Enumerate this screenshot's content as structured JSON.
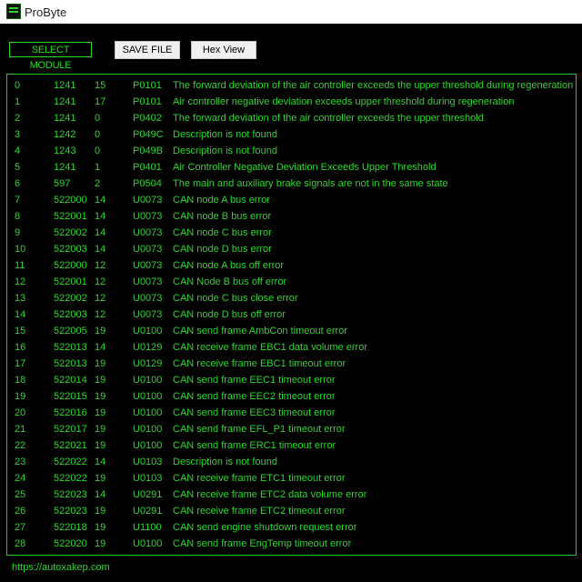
{
  "window": {
    "title": "ProByte"
  },
  "toolbar": {
    "select_module": "SELECT MODULE",
    "save_file": "SAVE FILE",
    "hex_view": "Hex View"
  },
  "rows": [
    {
      "idx": "0",
      "a": "1241",
      "b": "15",
      "code": "P0101",
      "desc": "The forward deviation of the air controller exceeds the upper threshold during regeneration"
    },
    {
      "idx": "1",
      "a": "1241",
      "b": "17",
      "code": "P0101",
      "desc": "Air controller negative deviation exceeds upper threshold during regeneration"
    },
    {
      "idx": "2",
      "a": "1241",
      "b": "0",
      "code": "P0402",
      "desc": "The forward deviation of the air controller exceeds the upper threshold"
    },
    {
      "idx": "3",
      "a": "1242",
      "b": "0",
      "code": "P049C",
      "desc": "Description is not found"
    },
    {
      "idx": "4",
      "a": "1243",
      "b": "0",
      "code": "P049B",
      "desc": "Description is not found"
    },
    {
      "idx": "5",
      "a": "1241",
      "b": "1",
      "code": "P0401",
      "desc": "Air Controller Negative Deviation Exceeds Upper Threshold"
    },
    {
      "idx": "6",
      "a": "597",
      "b": "2",
      "code": "P0504",
      "desc": "The main and auxiliary brake signals are not in the same state"
    },
    {
      "idx": "7",
      "a": "522000",
      "b": "14",
      "code": "U0073",
      "desc": "CAN node A bus error"
    },
    {
      "idx": "8",
      "a": "522001",
      "b": "14",
      "code": "U0073",
      "desc": "CAN node B bus error"
    },
    {
      "idx": "9",
      "a": "522002",
      "b": "14",
      "code": "U0073",
      "desc": "CAN node C bus error"
    },
    {
      "idx": "10",
      "a": "522003",
      "b": "14",
      "code": "U0073",
      "desc": "CAN node D bus error"
    },
    {
      "idx": "11",
      "a": "522000",
      "b": "12",
      "code": "U0073",
      "desc": "CAN node A bus off error"
    },
    {
      "idx": "12",
      "a": "522001",
      "b": "12",
      "code": "U0073",
      "desc": "CAN Node B bus off error"
    },
    {
      "idx": "13",
      "a": "522002",
      "b": "12",
      "code": "U0073",
      "desc": "CAN node C bus close error"
    },
    {
      "idx": "14",
      "a": "522003",
      "b": "12",
      "code": "U0073",
      "desc": "CAN node D bus off error"
    },
    {
      "idx": "15",
      "a": "522005",
      "b": "19",
      "code": "U0100",
      "desc": "CAN send frame AmbCon timeout error"
    },
    {
      "idx": "16",
      "a": "522013",
      "b": "14",
      "code": "U0129",
      "desc": "CAN receive frame EBC1 data volume error"
    },
    {
      "idx": "17",
      "a": "522013",
      "b": "19",
      "code": "U0129",
      "desc": "CAN receive frame EBC1 timeout error"
    },
    {
      "idx": "18",
      "a": "522014",
      "b": "19",
      "code": "U0100",
      "desc": "CAN send frame EEC1 timeout error"
    },
    {
      "idx": "19",
      "a": "522015",
      "b": "19",
      "code": "U0100",
      "desc": "CAN send frame EEC2 timeout error"
    },
    {
      "idx": "20",
      "a": "522016",
      "b": "19",
      "code": "U0100",
      "desc": "CAN send frame EEC3 timeout error"
    },
    {
      "idx": "21",
      "a": "522017",
      "b": "19",
      "code": "U0100",
      "desc": "CAN send frame EFL_P1 timeout error"
    },
    {
      "idx": "22",
      "a": "522021",
      "b": "19",
      "code": "U0100",
      "desc": "CAN send frame ERC1 timeout error"
    },
    {
      "idx": "23",
      "a": "522022",
      "b": "14",
      "code": "U0103",
      "desc": "Description is not found"
    },
    {
      "idx": "24",
      "a": "522022",
      "b": "19",
      "code": "U0103",
      "desc": "CAN receive frame ETC1 timeout error"
    },
    {
      "idx": "25",
      "a": "522023",
      "b": "14",
      "code": "U0291",
      "desc": "CAN receive frame ETC2 data volume error"
    },
    {
      "idx": "26",
      "a": "522023",
      "b": "19",
      "code": "U0291",
      "desc": "CAN receive frame ETC2 timeout error"
    },
    {
      "idx": "27",
      "a": "522018",
      "b": "19",
      "code": "U1100",
      "desc": "CAN send engine shutdown request error"
    },
    {
      "idx": "28",
      "a": "522020",
      "b": "19",
      "code": "U0100",
      "desc": "CAN send frame EngTemp timeout error"
    }
  ],
  "footer": {
    "link": "https://autoxakep.com"
  },
  "colors": {
    "accent": "#2ed62e",
    "background": "#000000",
    "titlebar": "#ffffff"
  },
  "icons": {
    "app": "probyte-app-icon"
  }
}
